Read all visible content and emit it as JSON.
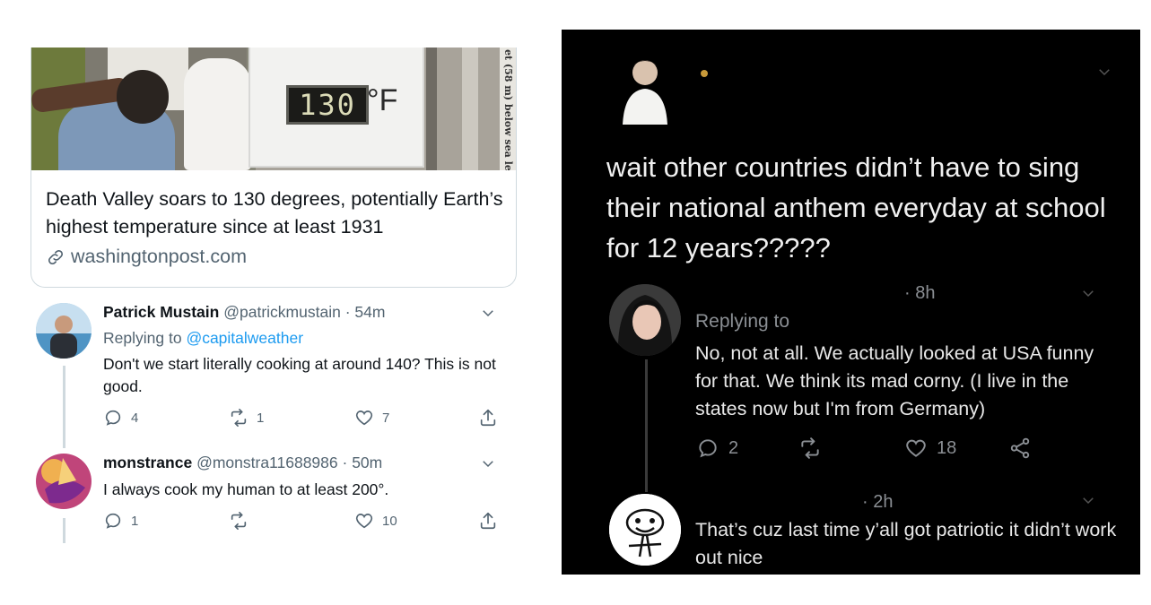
{
  "left": {
    "card": {
      "image_overlay": {
        "thermometer_reading": "130",
        "thermometer_unit": "°F",
        "side_caption": "et (58 m) below sea level"
      },
      "title": "Death Valley soars to 130 degrees, potentially Earth’s highest temperature since at least 1931",
      "link_icon": "link-icon",
      "domain": "washingtonpost.com"
    },
    "tweets": [
      {
        "name": "Patrick Mustain",
        "handle": "@patrickmustain",
        "time": "· 54m",
        "replying_prefix": "Replying to",
        "replying_to": "@capitalweather",
        "text": "Don't we start literally cooking at around 140? This is not good.",
        "replies": "4",
        "retweets": "1",
        "likes": "7"
      },
      {
        "name": "monstrance",
        "handle": "@monstra11688986",
        "time": "· 50m",
        "text": "I always cook my human to at least 200°.",
        "replies": "1",
        "retweets": "",
        "likes": "10"
      }
    ]
  },
  "right": {
    "post": {
      "text": "wait other countries didn’t have to sing their national anthem everyday at school for 12 years?????"
    },
    "reply1": {
      "time": "· 8h",
      "replying": "Replying to",
      "text": "No, not at all. We actually looked at USA funny for that. We think its mad corny. (I live in the states now but I'm from Germany)",
      "replies": "2",
      "likes": "18"
    },
    "reply2": {
      "time": "· 2h",
      "text": "That’s cuz last time y’all got patriotic it didn’t work out nice"
    }
  },
  "colors": {
    "twitter_blue": "#1d9bf0",
    "light_text_secondary": "#536471",
    "dark_background": "#000000"
  }
}
